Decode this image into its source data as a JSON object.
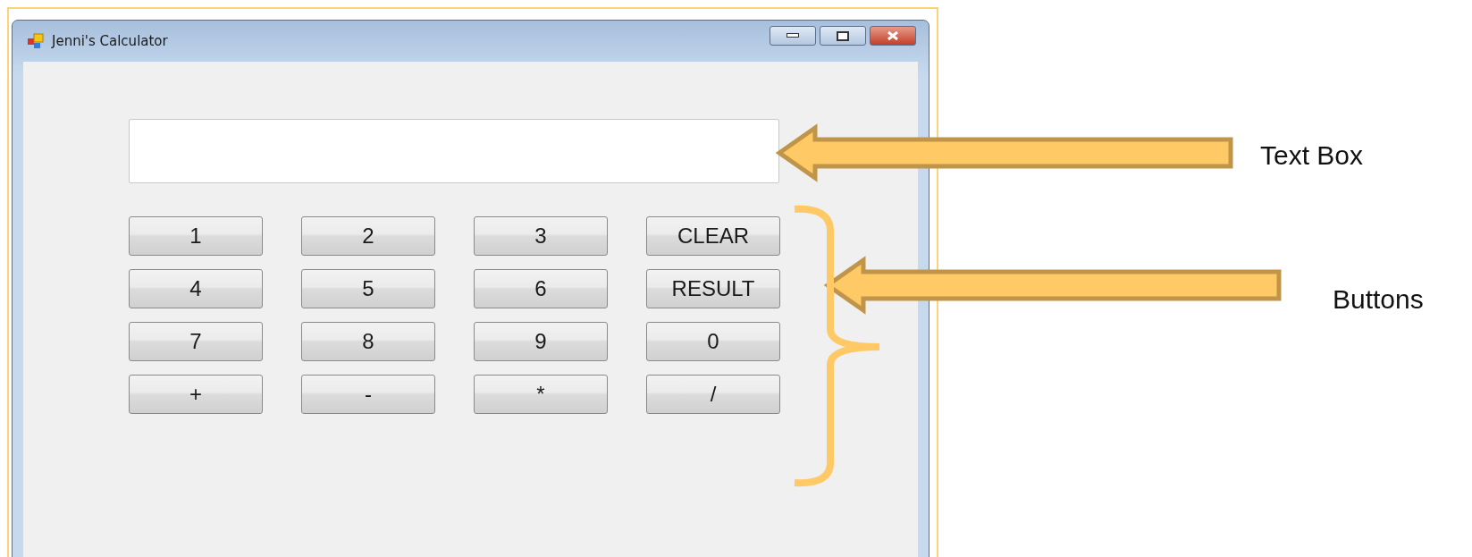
{
  "window": {
    "title": "Jenni's Calculator"
  },
  "buttons": [
    {
      "label": "1"
    },
    {
      "label": "2"
    },
    {
      "label": "3"
    },
    {
      "label": "CLEAR"
    },
    {
      "label": "4"
    },
    {
      "label": "5"
    },
    {
      "label": "6"
    },
    {
      "label": "RESULT"
    },
    {
      "label": "7"
    },
    {
      "label": "8"
    },
    {
      "label": "9"
    },
    {
      "label": "0"
    },
    {
      "label": "+"
    },
    {
      "label": "-"
    },
    {
      "label": "*"
    },
    {
      "label": "/"
    }
  ],
  "annotations": [
    {
      "label": "Text Box"
    },
    {
      "label": "Buttons"
    }
  ]
}
